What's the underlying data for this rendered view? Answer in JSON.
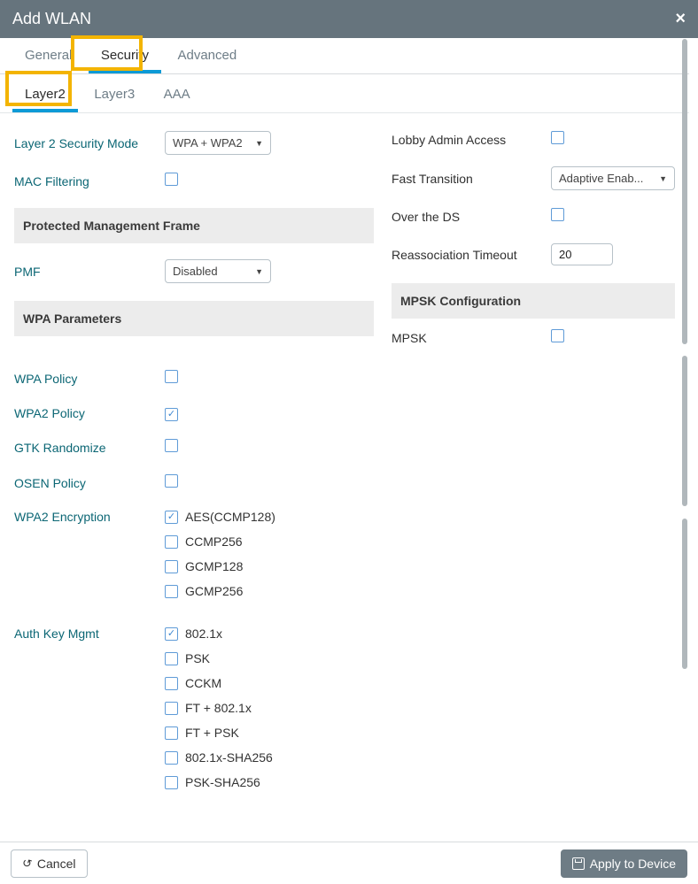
{
  "title": "Add WLAN",
  "tabs_primary": {
    "items": [
      "General",
      "Security",
      "Advanced"
    ],
    "active": "Security"
  },
  "tabs_secondary": {
    "items": [
      "Layer2",
      "Layer3",
      "AAA"
    ],
    "active": "Layer2"
  },
  "left": {
    "l2_label": "Layer 2 Security Mode",
    "l2_value": "WPA + WPA2",
    "mac_label": "MAC Filtering",
    "pmf_header": "Protected Management Frame",
    "pmf_label": "PMF",
    "pmf_value": "Disabled",
    "wpa_header": "WPA Parameters",
    "wpa_policy": "WPA Policy",
    "wpa2_policy": "WPA2 Policy",
    "gtk": "GTK Randomize",
    "osen": "OSEN Policy",
    "wpa2_enc": "WPA2 Encryption",
    "enc_opts": [
      "AES(CCMP128)",
      "CCMP256",
      "GCMP128",
      "GCMP256"
    ],
    "akm_label": "Auth Key Mgmt",
    "akm_opts": [
      "802.1x",
      "PSK",
      "CCKM",
      "FT + 802.1x",
      "FT + PSK",
      "802.1x-SHA256",
      "PSK-SHA256"
    ]
  },
  "right": {
    "lobby": "Lobby Admin Access",
    "ft_label": "Fast Transition",
    "ft_value": "Adaptive Enab...",
    "over_ds": "Over the DS",
    "reassoc_label": "Reassociation Timeout",
    "reassoc_value": "20",
    "mpsk_header": "MPSK Configuration",
    "mpsk": "MPSK"
  },
  "footer": {
    "cancel": "Cancel",
    "apply": "Apply to Device"
  }
}
